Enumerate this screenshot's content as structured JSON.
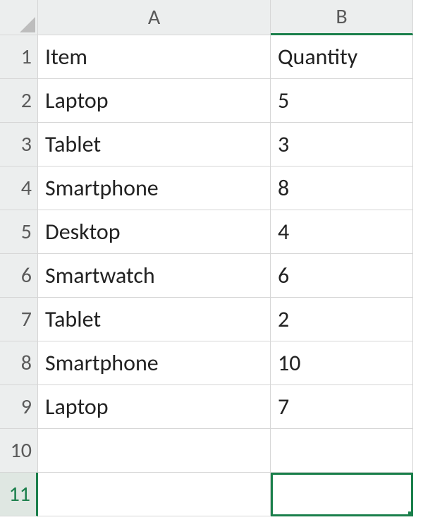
{
  "columns": [
    "A",
    "B"
  ],
  "row_headers": [
    "1",
    "2",
    "3",
    "4",
    "5",
    "6",
    "7",
    "8",
    "9",
    "10",
    "11"
  ],
  "selected_cell": "B11",
  "cells": {
    "A1": "Item",
    "B1": "Quantity",
    "A2": "Laptop",
    "B2": "5",
    "A3": "Tablet",
    "B3": "3",
    "A4": "Smartphone",
    "B4": "8",
    "A5": "Desktop",
    "B5": "4",
    "A6": "Smartwatch",
    "B6": "6",
    "A7": "Tablet",
    "B7": "2",
    "A8": "Smartphone",
    "B8": "10",
    "A9": "Laptop",
    "B9": "7",
    "A10": "",
    "B10": "",
    "A11": "",
    "B11": ""
  }
}
